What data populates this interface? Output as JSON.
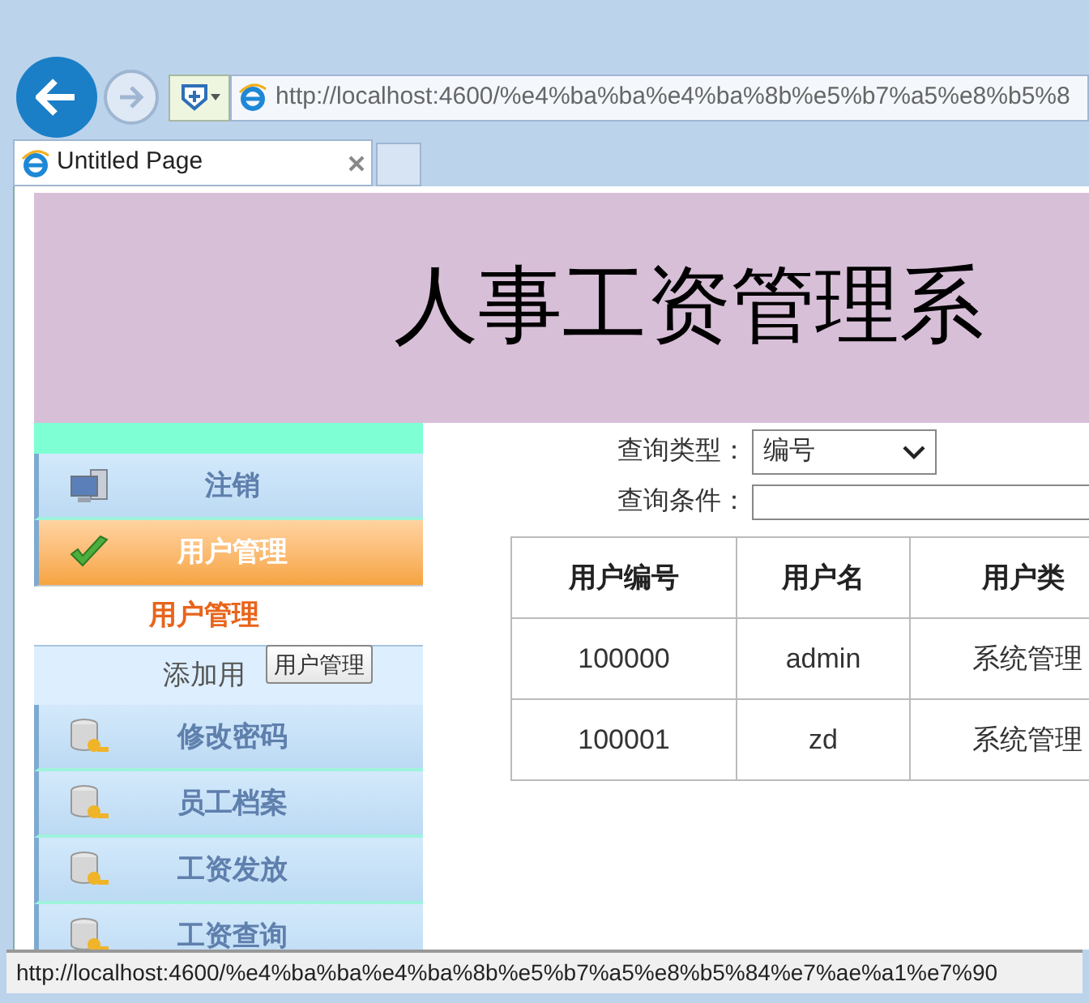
{
  "browser": {
    "address": "http://localhost:4600/%e4%ba%ba%e4%ba%8b%e5%b7%a5%e8%b5%8",
    "tab": {
      "title": "Untitled Page"
    }
  },
  "banner": {
    "title": "人事工资管理系"
  },
  "sidebar": {
    "items": [
      {
        "label": "注销",
        "kind": "logout",
        "selected": false
      },
      {
        "label": "用户管理",
        "kind": "group",
        "selected": true,
        "children": [
          {
            "label": "用户管理",
            "selected": true
          },
          {
            "label": "添加用",
            "selected": false
          }
        ]
      },
      {
        "label": "修改密码",
        "kind": "module",
        "selected": false
      },
      {
        "label": "员工档案",
        "kind": "module",
        "selected": false
      },
      {
        "label": "工资发放",
        "kind": "module",
        "selected": false
      },
      {
        "label": "工资查询",
        "kind": "module",
        "selected": false
      }
    ]
  },
  "tooltip": "用户管理",
  "search": {
    "type_label": "查询类型：",
    "type_value": "编号",
    "condition_label": "查询条件："
  },
  "table": {
    "columns": [
      "用户编号",
      "用户名",
      "用户类"
    ],
    "rows": [
      [
        "100000",
        "admin",
        "系统管理"
      ],
      [
        "100001",
        "zd",
        "系统管理"
      ]
    ]
  },
  "status_bar": "http://localhost:4600/%e4%ba%ba%e4%ba%8b%e5%b7%a5%e8%b5%84%e7%ae%a1%e7%90"
}
